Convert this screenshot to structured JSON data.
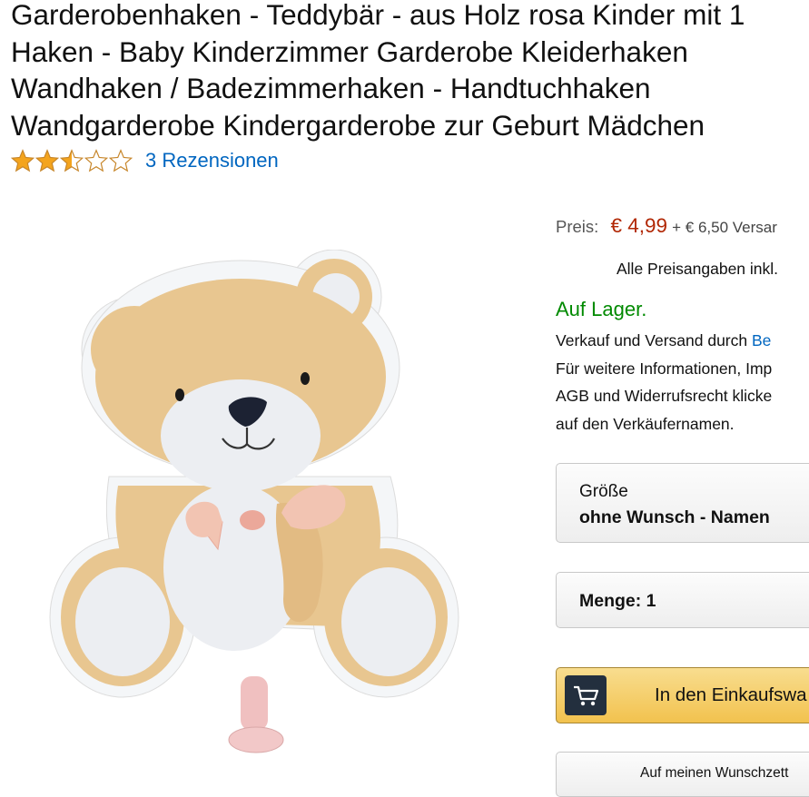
{
  "product": {
    "title_lines": [
      "Garderobenhaken - Teddybär - aus Holz rosa Kinder mit 1",
      "Haken - Baby Kinderzimmer Garderobe Kleiderhaken",
      "Wandhaken / Badezimmerhaken - Handtuchhaken",
      "Wandgarderobe Kindergarderobe zur Geburt Mädchen"
    ],
    "rating": 2.5,
    "rating_max": 5,
    "reviews_label": "3 Rezensionen",
    "image_icon": "teddy-bear-coat-hook-image"
  },
  "buybox": {
    "price_label": "Preis:",
    "price": "€ 4,99",
    "shipping": "+ € 6,50 Versar",
    "tax_note": "Alle Preisangaben inkl.",
    "stock": "Auf Lager.",
    "seller_prefix": "Verkauf und Versand durch",
    "seller_link": "Be",
    "info_lines": [
      "Für weitere Informationen, Imp",
      "AGB und Widerrufsrecht klicke",
      "auf den Verkäufernamen."
    ],
    "size_label": "Größe",
    "size_value": "ohne Wunsch - Namen",
    "quantity_label": "Menge: 1",
    "cart_button": "In den Einkaufswa",
    "cart_icon": "shopping-cart-icon",
    "wishlist_button": "Auf meinen Wunschzett"
  },
  "colors": {
    "star": "#f4a41d",
    "price": "#b12704",
    "stock": "#008a00",
    "link": "#0066c0",
    "cart_button": "#f0c14b",
    "cart_icon_bg": "#232f3e"
  }
}
